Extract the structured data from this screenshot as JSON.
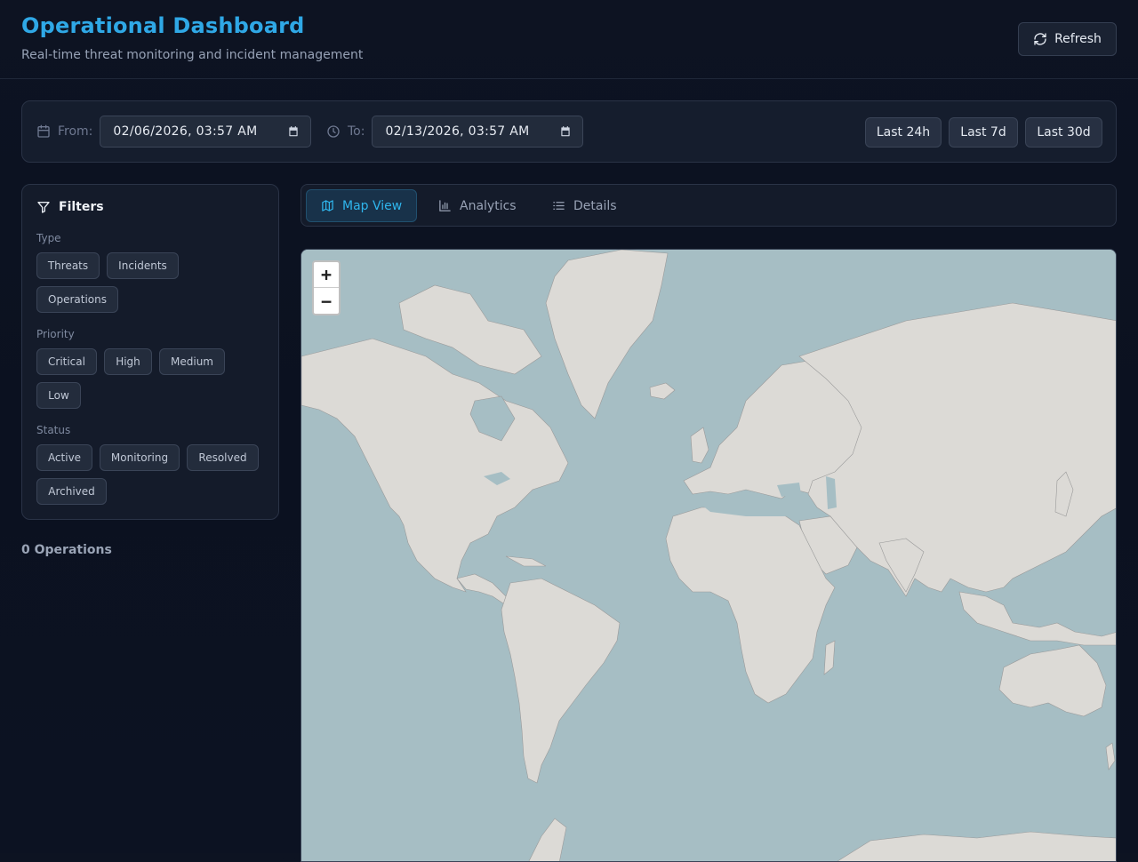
{
  "header": {
    "title": "Operational Dashboard",
    "subtitle": "Real-time threat monitoring and incident management",
    "refresh_label": "Refresh"
  },
  "date_range": {
    "from_label": "From:",
    "from_value": "02/06/2026, 03:57 AM",
    "to_label": "To:",
    "to_value": "02/13/2026, 03:57 AM",
    "presets": [
      "Last 24h",
      "Last 7d",
      "Last 30d"
    ]
  },
  "filters": {
    "title": "Filters",
    "type_label": "Type",
    "types": [
      "Threats",
      "Incidents",
      "Operations"
    ],
    "priority_label": "Priority",
    "priorities": [
      "Critical",
      "High",
      "Medium",
      "Low"
    ],
    "status_label": "Status",
    "statuses": [
      "Active",
      "Monitoring",
      "Resolved",
      "Archived"
    ]
  },
  "operations_count": "0 Operations",
  "tabs": [
    {
      "label": "Map View",
      "icon": "map-icon",
      "active": true
    },
    {
      "label": "Analytics",
      "icon": "bar-chart-icon",
      "active": false
    },
    {
      "label": "Details",
      "icon": "list-icon",
      "active": false
    }
  ],
  "map": {
    "zoom_in": "+",
    "zoom_out": "−",
    "colors": {
      "water": "#a6bec4",
      "land": "#dcdad6",
      "border": "#9a9a9a"
    }
  },
  "colors": {
    "accent": "#2fa8e6",
    "active_tab_text": "#2fb5ec",
    "panel_bg": "#141b2a"
  }
}
